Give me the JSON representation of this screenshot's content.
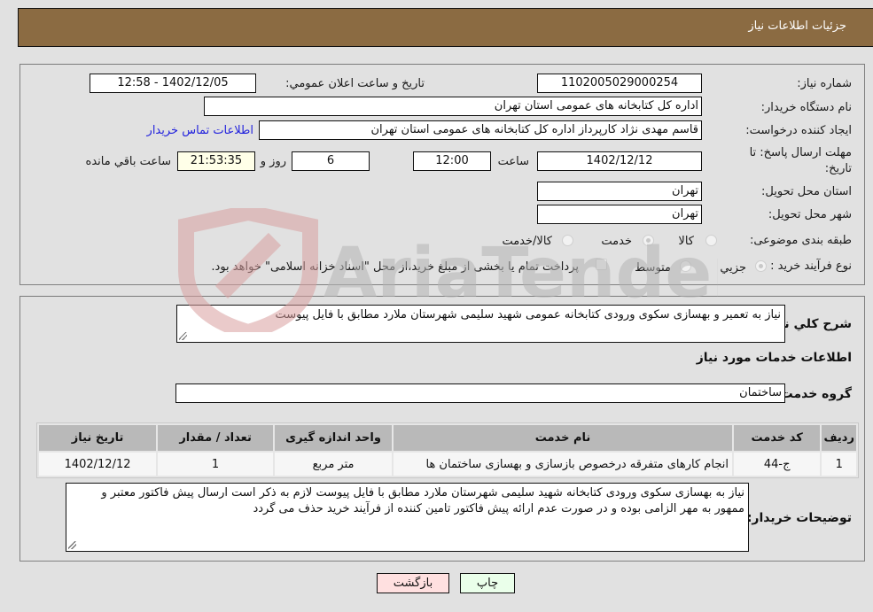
{
  "header": {
    "title": "جزئیات اطلاعات نیاز"
  },
  "need_info": {
    "need_number_label": "شماره نیاز:",
    "need_number": "1102005029000254",
    "announce_label": "تاریخ و ساعت اعلان عمومي:",
    "announce_value": "1402/12/05 - 12:58",
    "buyer_org_label": "نام دستگاه خریدار:",
    "buyer_org": "اداره کل کتابخانه های عمومی استان تهران",
    "creator_label": "ایجاد کننده درخواست:",
    "creator": "قاسم مهدی نژاد کارپرداز اداره کل کتابخانه های عمومی استان تهران",
    "contact_link": "اطلاعات تماس خریدار",
    "deadline_label_1": "مهلت ارسال پاسخ: تا",
    "deadline_label_2": "تاریخ:",
    "deadline_date": "1402/12/12",
    "time_label": "ساعت",
    "deadline_time": "12:00",
    "days_value": "6",
    "days_label": "روز و",
    "remaining_time": "21:53:35",
    "remaining_label": "ساعت باقي مانده",
    "province_label": "استان محل تحویل:",
    "province": "تهران",
    "city_label": "شهر محل تحویل:",
    "city": "تهران",
    "category_label": "طبقه بندی موضوعی:",
    "category_options": [
      {
        "label": "کالا",
        "checked": false
      },
      {
        "label": "خدمت",
        "checked": true
      },
      {
        "label": "کالا/خدمت",
        "checked": false
      }
    ],
    "process_label": "نوع فرآیند خرید :",
    "process_options": [
      {
        "label": "جزیي",
        "checked": true
      },
      {
        "label": "متوسط",
        "checked": false
      }
    ],
    "treasury_note": "پرداخت تمام یا بخشی از مبلغ خرید،از محل \"اسناد خزانه اسلامی\" خواهد بود."
  },
  "description": {
    "label": "شرح کلي نیاز:",
    "value": "نیاز به تعمیر و بهسازی سکوی ورودی کتابخانه عمومی شهید سلیمی شهرستان ملارد مطابق با فایل پیوست"
  },
  "services": {
    "section_title": "اطلاعات خدمات مورد نیاز",
    "group_label": "گروه خدمت:",
    "group_value": "ساختمان",
    "columns": [
      "ردیف",
      "کد خدمت",
      "نام خدمت",
      "واحد اندازه گیری",
      "تعداد / مقدار",
      "تاریخ نیاز"
    ],
    "rows": [
      {
        "row": "1",
        "code": "ج-44",
        "name": "انجام کارهای متفرقه درخصوص بازسازی و بهسازی ساختمان ها",
        "unit": "متر مربع",
        "qty": "1",
        "date": "1402/12/12"
      }
    ]
  },
  "buyer_notes": {
    "label": "توضیحات خریدار:",
    "value": "نیاز به بهسازی سکوی ورودی کتابخانه شهید سلیمی شهرستان ملارد مطابق با فایل پیوست لازم به ذکر است ارسال پیش فاکتور معتبر و ممهور به مهر الزامی بوده و در صورت عدم ارائه پیش فاکتور تامین کننده از فرآیند خرید حذف می گردد"
  },
  "buttons": {
    "print": "چاپ",
    "back": "بازگشت"
  },
  "watermark": {
    "text": "AriaTender.neT"
  },
  "colors": {
    "header_bg": "#8b6b42",
    "page_bg": "#e1e1e1",
    "back_btn": "#ffe0e0",
    "print_btn": "#eaffea",
    "link": "#2222dd"
  }
}
